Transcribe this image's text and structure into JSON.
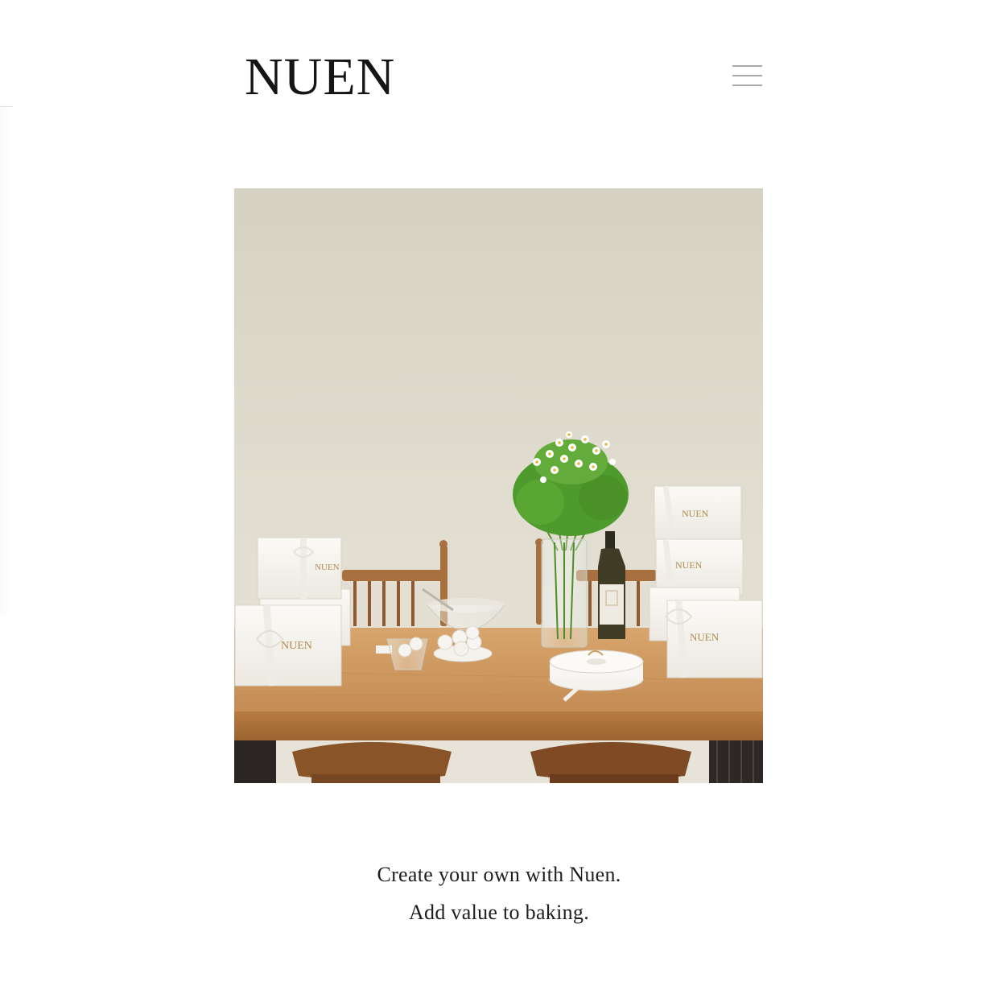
{
  "header": {
    "logo_text": "NUEN",
    "menu_icon": "hamburger-menu-icon"
  },
  "hero": {
    "box_brand_label": "NUEN"
  },
  "tagline": {
    "line1": "Create your own with Nuen.",
    "line2": "Add value to baking."
  },
  "colors": {
    "background": "#ffffff",
    "text": "#1a1a1a",
    "menu_icon": "#a9a9a9",
    "wall": "#dcd8ca",
    "table": "#c68f55",
    "box_gold": "#b08a4e"
  }
}
